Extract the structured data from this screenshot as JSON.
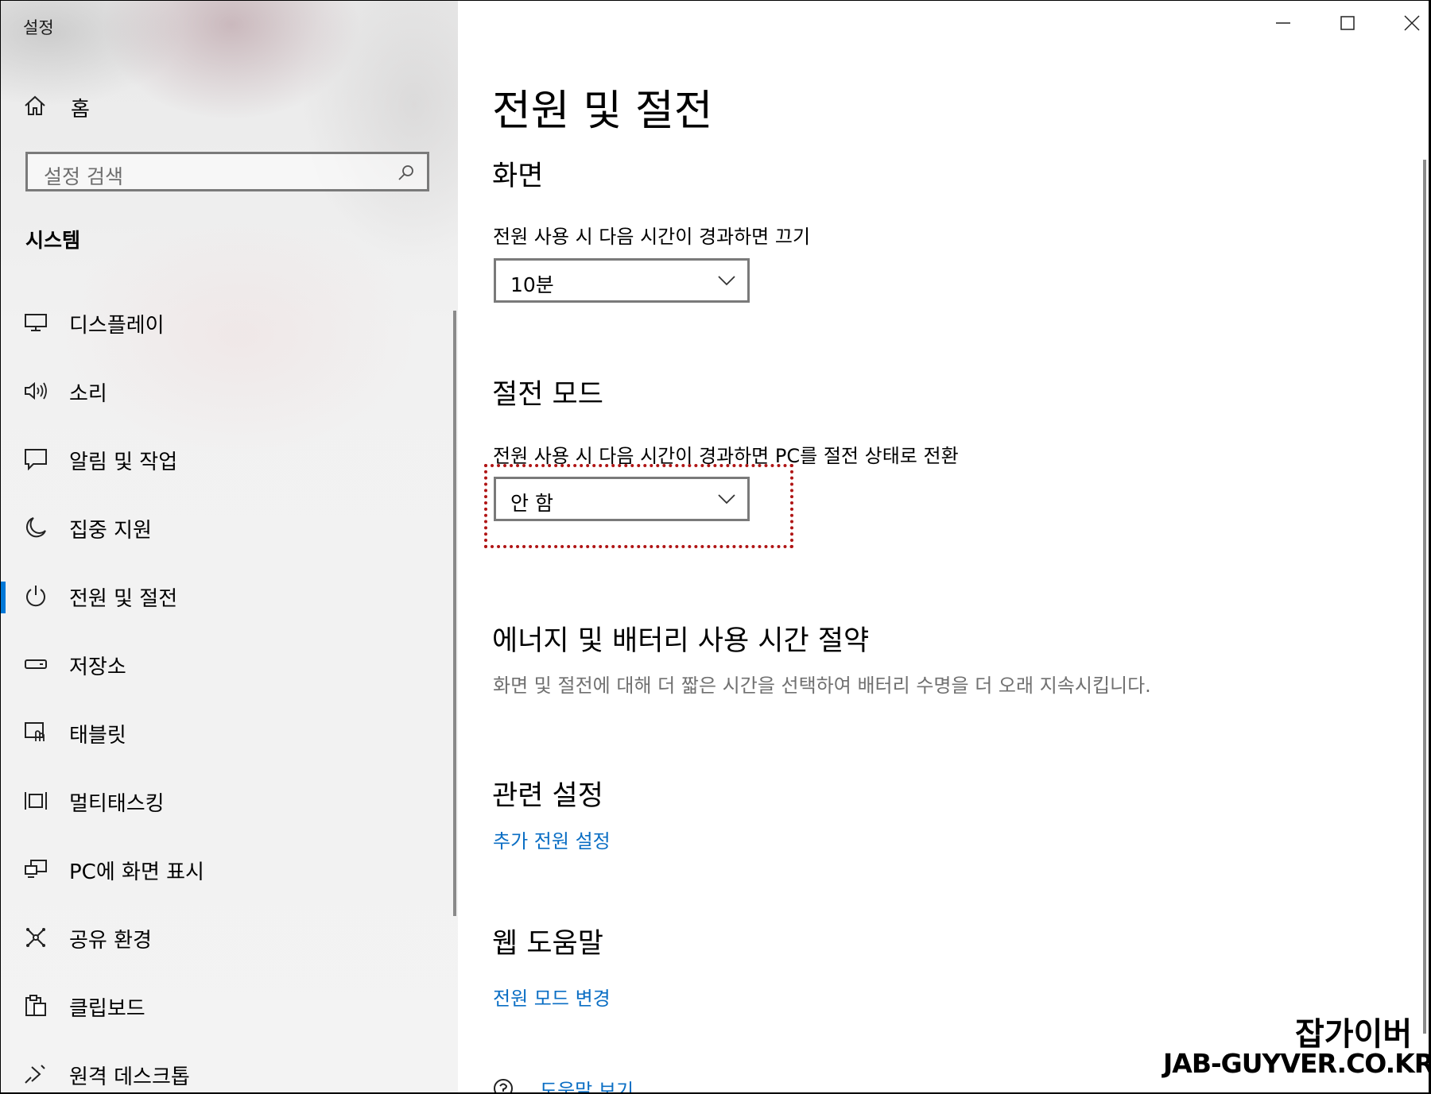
{
  "window": {
    "title": "설정"
  },
  "sidebar": {
    "home_label": "홈",
    "search_placeholder": "설정 검색",
    "section_label": "시스템",
    "items": [
      {
        "label": "디스플레이",
        "icon": "monitor-icon"
      },
      {
        "label": "소리",
        "icon": "speaker-icon"
      },
      {
        "label": "알림 및 작업",
        "icon": "notification-icon"
      },
      {
        "label": "집중 지원",
        "icon": "moon-icon"
      },
      {
        "label": "전원 및 절전",
        "icon": "power-icon",
        "active": true
      },
      {
        "label": "저장소",
        "icon": "storage-icon"
      },
      {
        "label": "태블릿",
        "icon": "tablet-icon"
      },
      {
        "label": "멀티태스킹",
        "icon": "multitasking-icon"
      },
      {
        "label": "PC에 화면 표시",
        "icon": "project-icon"
      },
      {
        "label": "공유 환경",
        "icon": "share-icon"
      },
      {
        "label": "클립보드",
        "icon": "clipboard-icon"
      },
      {
        "label": "원격 데스크톱",
        "icon": "remote-desktop-icon"
      }
    ],
    "accent_color": "#0078d7"
  },
  "content": {
    "page_title": "전원 및 절전",
    "screen": {
      "heading": "화면",
      "label": "전원 사용 시 다음 시간이 경과하면 끄기",
      "value": "10분"
    },
    "sleep": {
      "heading": "절전 모드",
      "label": "전원 사용 시 다음 시간이 경과하면 PC를 절전 상태로 전환",
      "value": "안 함"
    },
    "energy": {
      "heading": "에너지 및 배터리 사용 시간 절약",
      "description": "화면 및 절전에 대해 더 짧은 시간을 선택하여 배터리 수명을 더 오래 지속시킵니다."
    },
    "related": {
      "heading": "관련 설정",
      "link": "추가 전원 설정"
    },
    "web_help": {
      "heading": "웹 도움말",
      "link": "전원 모드 변경"
    },
    "help_link": "도움말 보기",
    "link_color": "#0a6ec4",
    "highlight_color": "#b01515"
  },
  "watermark": {
    "line1": "잡가이버",
    "line2": "JAB-GUYVER.CO.KR"
  }
}
